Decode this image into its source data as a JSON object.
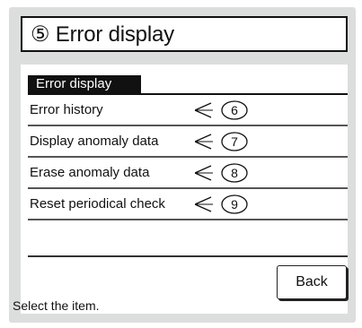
{
  "title": {
    "number": "⑤",
    "text": "Error display"
  },
  "section_header": "Error display",
  "menu_items": [
    {
      "label": "Error history",
      "callout": "6"
    },
    {
      "label": "Display anomaly data",
      "callout": "7"
    },
    {
      "label": "Erase anomaly data",
      "callout": "8"
    },
    {
      "label": "Reset periodical check",
      "callout": "9"
    }
  ],
  "back_button": "Back",
  "status_text": "Select the item.",
  "colors": {
    "screen_background": "#dcdddd",
    "panel_background": "#ffffff",
    "header_background": "#111111",
    "text": "#111111"
  },
  "icons": {
    "callout_marker": "pointer-oval-icon"
  }
}
